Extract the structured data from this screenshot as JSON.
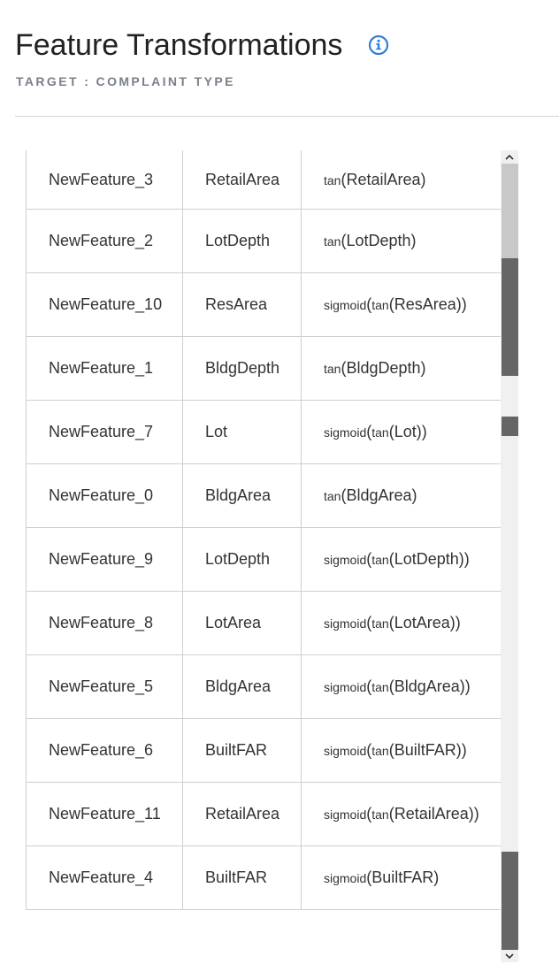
{
  "header": {
    "title": "Feature Transformations",
    "subtitle": "TARGET : COMPLAINT TYPE",
    "info_icon": "info-icon"
  },
  "colors": {
    "title": "#222222",
    "subtitle": "#7a7f8a",
    "info_accent": "#2f7fd6",
    "scrollbar_track": "#f0f0f0",
    "scrollbar_thumb": "#c8c8c8",
    "scrollbar_dark": "#666666"
  },
  "rows": [
    {
      "name": "NewFeature_3",
      "source": "RetailArea",
      "transform": [
        {
          "fn": "tan",
          "t": "tan"
        },
        {
          "t": "(RetailArea)"
        }
      ]
    },
    {
      "name": "NewFeature_2",
      "source": "LotDepth",
      "transform": [
        {
          "fn": "tan",
          "t": "tan"
        },
        {
          "t": "(LotDepth)"
        }
      ]
    },
    {
      "name": "NewFeature_10",
      "source": "ResArea",
      "transform": [
        {
          "fn": "sigmoid",
          "t": "sigmoid"
        },
        {
          "t": "("
        },
        {
          "fn": "tan",
          "t": "tan"
        },
        {
          "t": "(ResArea))"
        }
      ]
    },
    {
      "name": "NewFeature_1",
      "source": "BldgDepth",
      "transform": [
        {
          "fn": "tan",
          "t": "tan"
        },
        {
          "t": "(BldgDepth)"
        }
      ]
    },
    {
      "name": "NewFeature_7",
      "source": "Lot",
      "transform": [
        {
          "fn": "sigmoid",
          "t": "sigmoid"
        },
        {
          "t": "("
        },
        {
          "fn": "tan",
          "t": "tan"
        },
        {
          "t": "(Lot))"
        }
      ]
    },
    {
      "name": "NewFeature_0",
      "source": "BldgArea",
      "transform": [
        {
          "fn": "tan",
          "t": "tan"
        },
        {
          "t": "(BldgArea)"
        }
      ]
    },
    {
      "name": "NewFeature_9",
      "source": "LotDepth",
      "transform": [
        {
          "fn": "sigmoid",
          "t": "sigmoid"
        },
        {
          "t": "("
        },
        {
          "fn": "tan",
          "t": "tan"
        },
        {
          "t": "(LotDepth))"
        }
      ]
    },
    {
      "name": "NewFeature_8",
      "source": "LotArea",
      "transform": [
        {
          "fn": "sigmoid",
          "t": "sigmoid"
        },
        {
          "t": "("
        },
        {
          "fn": "tan",
          "t": "tan"
        },
        {
          "t": "(LotArea))"
        }
      ]
    },
    {
      "name": "NewFeature_5",
      "source": "BldgArea",
      "transform": [
        {
          "fn": "sigmoid",
          "t": "sigmoid"
        },
        {
          "t": "("
        },
        {
          "fn": "tan",
          "t": "tan"
        },
        {
          "t": "(BldgArea))"
        }
      ]
    },
    {
      "name": "NewFeature_6",
      "source": "BuiltFAR",
      "transform": [
        {
          "fn": "sigmoid",
          "t": "sigmoid"
        },
        {
          "t": "("
        },
        {
          "fn": "tan",
          "t": "tan"
        },
        {
          "t": "(BuiltFAR))"
        }
      ]
    },
    {
      "name": "NewFeature_11",
      "source": "RetailArea",
      "transform": [
        {
          "fn": "sigmoid",
          "t": "sigmoid"
        },
        {
          "t": "("
        },
        {
          "fn": "tan",
          "t": "tan"
        },
        {
          "t": "(RetailArea))"
        }
      ]
    },
    {
      "name": "NewFeature_4",
      "source": "BuiltFAR",
      "transform": [
        {
          "fn": "sigmoid",
          "t": "sigmoid"
        },
        {
          "t": "(BuiltFAR)"
        }
      ]
    }
  ],
  "scrollbar": {
    "up_icon": "chevron-up-icon",
    "down_icon": "chevron-down-icon"
  }
}
